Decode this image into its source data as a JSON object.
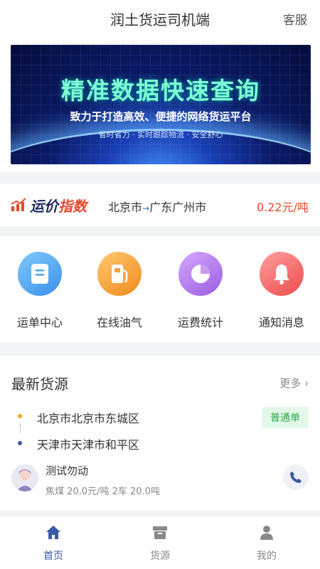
{
  "header": {
    "title": "润土货运司机端",
    "service": "客服"
  },
  "banner": {
    "title": "精准数据快速查询",
    "subtitle": "致力于打造高效、便捷的网络货运平台",
    "tagline": "省时省力 · 实时跟踪物流 · 安全舒心"
  },
  "price_index": {
    "label_a": "运价",
    "label_b": "指数",
    "from": "北京市",
    "arrow": "→",
    "to": "广东广州市",
    "value": "0.22元/吨"
  },
  "menu": {
    "items": [
      {
        "label": "运单中心",
        "icon": "waybill-icon",
        "color": "#4aa6f0"
      },
      {
        "label": "在线油气",
        "icon": "fuel-pump-icon",
        "color": "#f5a43a"
      },
      {
        "label": "运费统计",
        "icon": "pie-chart-icon",
        "color": "#b77ae8"
      },
      {
        "label": "通知消息",
        "icon": "bell-icon",
        "color": "#f36b6b"
      }
    ]
  },
  "cargo": {
    "title": "最新货源",
    "more": "更多",
    "from": "北京市北京市东城区",
    "to": "天津市天津市和平区",
    "badge": "普通单",
    "user_name": "测试勿动",
    "info": "焦煤 20.0元/吨 2车 20.0吨"
  },
  "tabbar": {
    "items": [
      {
        "label": "首页",
        "icon": "home-icon",
        "active": true
      },
      {
        "label": "货源",
        "icon": "cargo-box-icon",
        "active": false
      },
      {
        "label": "我的",
        "icon": "user-icon",
        "active": false
      }
    ]
  }
}
